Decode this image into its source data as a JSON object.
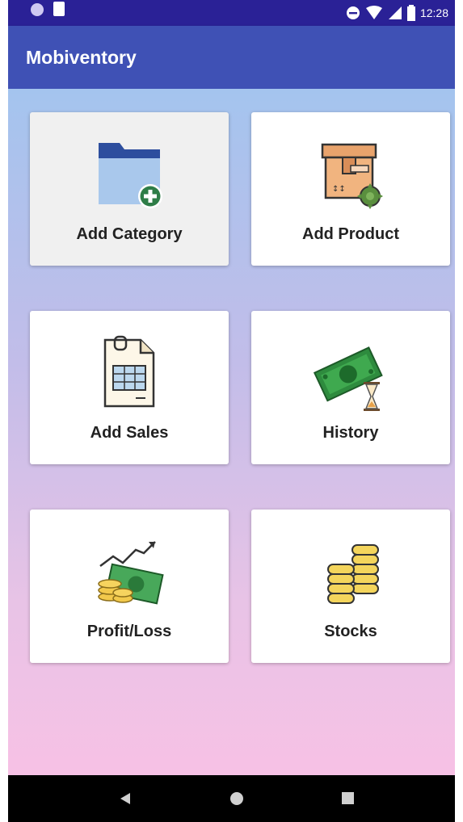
{
  "status_bar": {
    "time": "12:28"
  },
  "app_bar": {
    "title": "Mobiventory"
  },
  "tiles": [
    {
      "label": "Add Category",
      "icon": "folder-add-icon",
      "selected": true
    },
    {
      "label": "Add Product",
      "icon": "product-box-icon",
      "selected": false
    },
    {
      "label": "Add Sales",
      "icon": "sales-sheet-icon",
      "selected": false
    },
    {
      "label": "History",
      "icon": "money-hourglass-icon",
      "selected": false
    },
    {
      "label": "Profit/Loss",
      "icon": "profit-chart-icon",
      "selected": false
    },
    {
      "label": "Stocks",
      "icon": "coin-stacks-icon",
      "selected": false
    }
  ],
  "colors": {
    "status_bar": "#2a2196",
    "app_bar": "#3f51b5",
    "gradient_top": "#a4c4ee",
    "gradient_bottom": "#f7c1e5"
  },
  "nav_bar": {
    "back": "back-icon",
    "home": "home-icon",
    "recents": "recents-icon"
  }
}
